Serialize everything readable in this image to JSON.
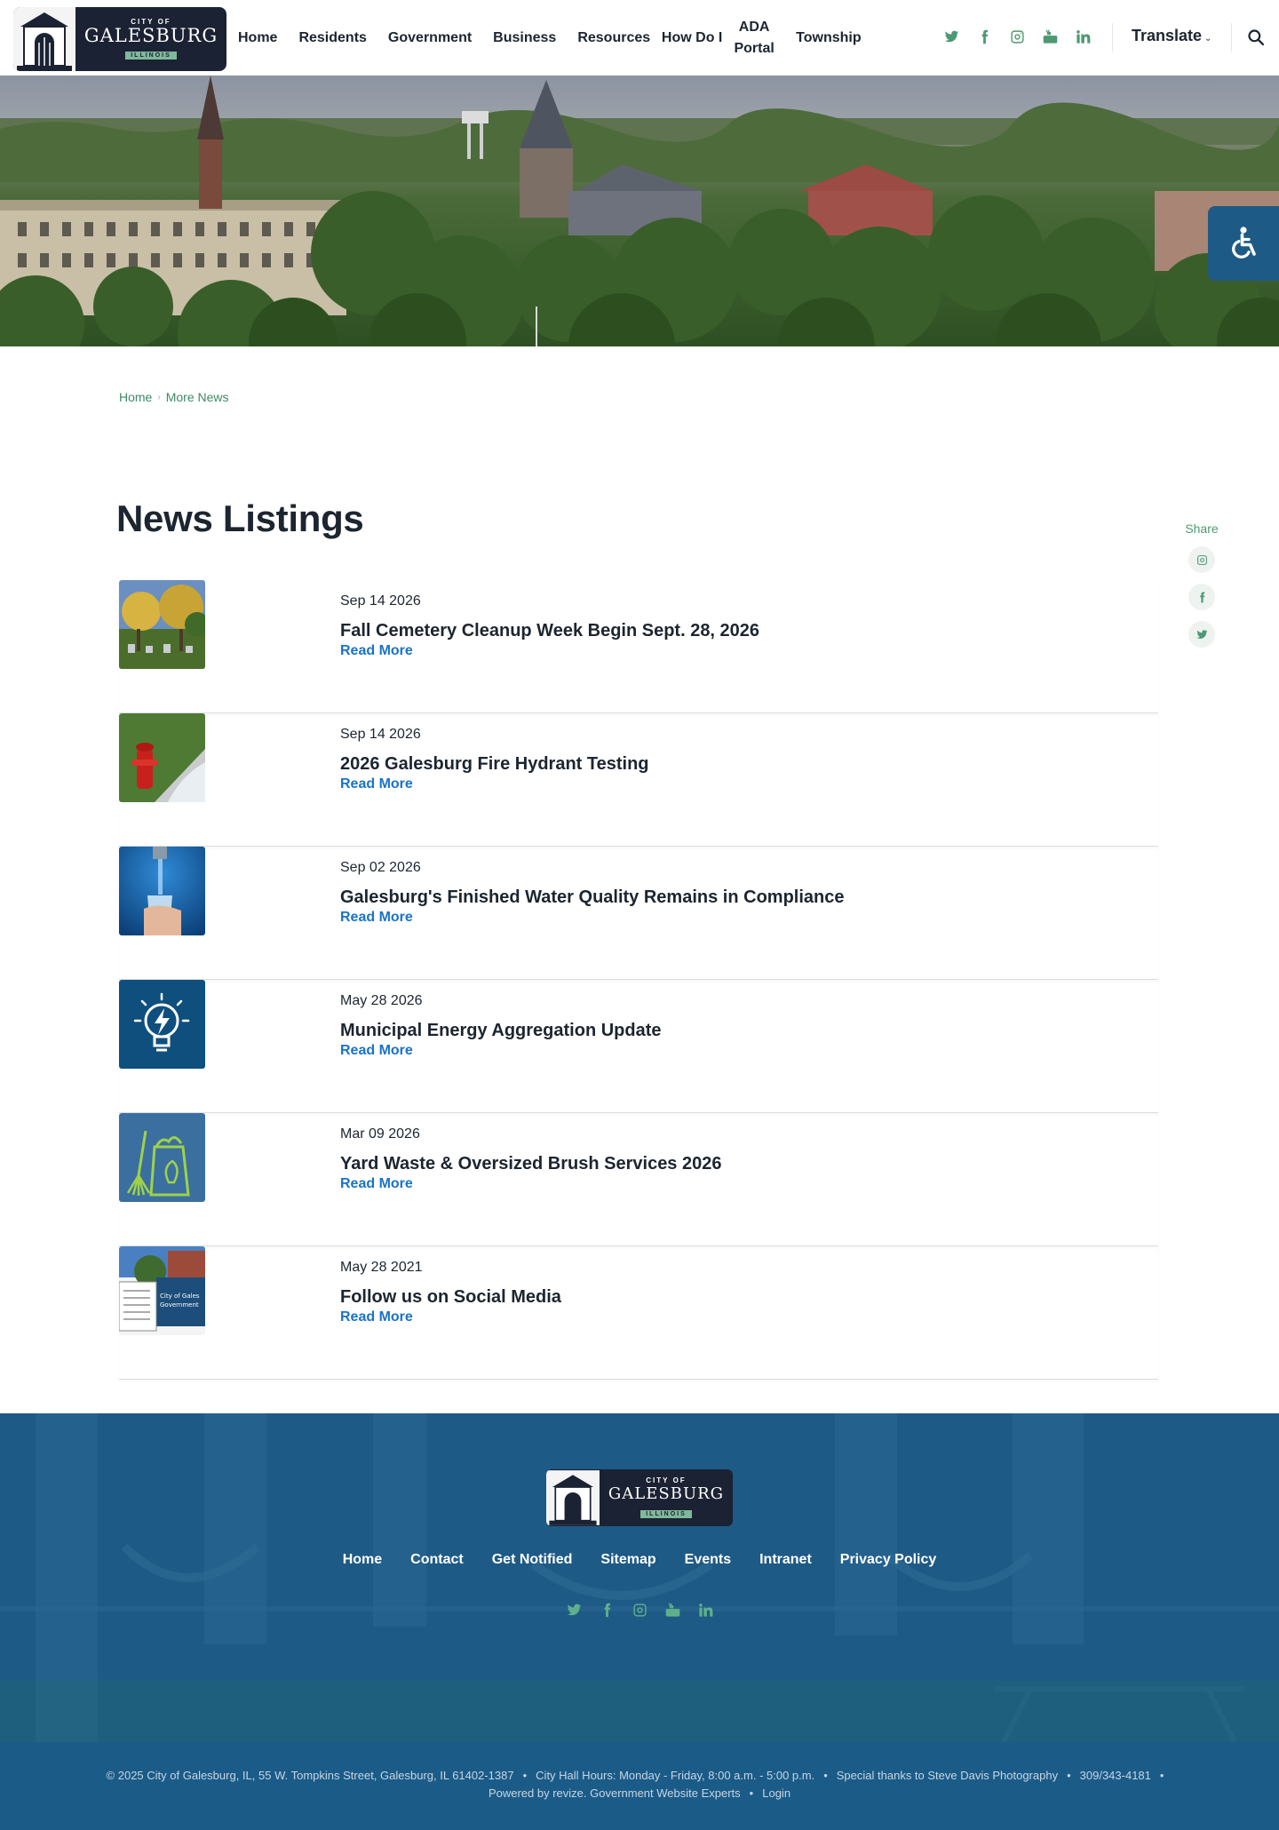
{
  "header": {
    "logo": {
      "top": "CITY OF",
      "name": "GALESBURG",
      "state": "ILLINOIS"
    },
    "nav": [
      {
        "label": "Home"
      },
      {
        "label": "Residents"
      },
      {
        "label": "Government"
      },
      {
        "label": "Business"
      },
      {
        "label": "Resources"
      },
      {
        "label": "How Do I"
      },
      {
        "label": "ADA Portal"
      },
      {
        "label": "Township"
      }
    ],
    "social": [
      "twitter-icon",
      "facebook-icon",
      "instagram-icon",
      "youtube-icon",
      "linkedin-icon"
    ],
    "translate_label": "Translate",
    "accent_color": "#4d9974"
  },
  "breadcrumb": {
    "home": "Home",
    "current": "More News"
  },
  "page_title": "News Listings",
  "share": {
    "label": "Share",
    "buttons": [
      "instagram-icon",
      "facebook-icon",
      "twitter-icon"
    ]
  },
  "news": [
    {
      "date": "Sep 14 2026",
      "title": "Fall Cemetery Cleanup Week Begin Sept. 28, 2026",
      "link": "Read More"
    },
    {
      "date": "Sep 14 2026",
      "title": "2026 Galesburg Fire Hydrant Testing",
      "link": "Read More"
    },
    {
      "date": "Sep 02 2026",
      "title": "Galesburg's Finished Water Quality Remains in Compliance",
      "link": "Read More"
    },
    {
      "date": "May 28 2026",
      "title": "Municipal Energy Aggregation Update",
      "link": "Read More"
    },
    {
      "date": "Mar 09 2026",
      "title": "Yard Waste & Oversized Brush Services 2026",
      "link": "Read More"
    },
    {
      "date": "May 28 2021",
      "title": "Follow us on Social Media",
      "link": "Read More"
    }
  ],
  "footer": {
    "logo": {
      "top": "CITY OF",
      "name": "GALESBURG",
      "state": "ILLINOIS"
    },
    "nav": [
      {
        "label": "Home"
      },
      {
        "label": "Contact"
      },
      {
        "label": "Get Notified"
      },
      {
        "label": "Sitemap"
      },
      {
        "label": "Events"
      },
      {
        "label": "Intranet"
      },
      {
        "label": "Privacy Policy"
      }
    ],
    "bottom": {
      "copyright": "© 2025 City of Galesburg, IL, 55 W. Tompkins Street, Galesburg, IL 61402-1387",
      "hours": "City Hall Hours: Monday - Friday, 8:00 a.m. - 5:00 p.m.",
      "thanks": "Special thanks to Steve Davis Photography",
      "phone": "309/343-4181",
      "powered": "Powered by revize. Government Website Experts",
      "login": "Login"
    }
  }
}
